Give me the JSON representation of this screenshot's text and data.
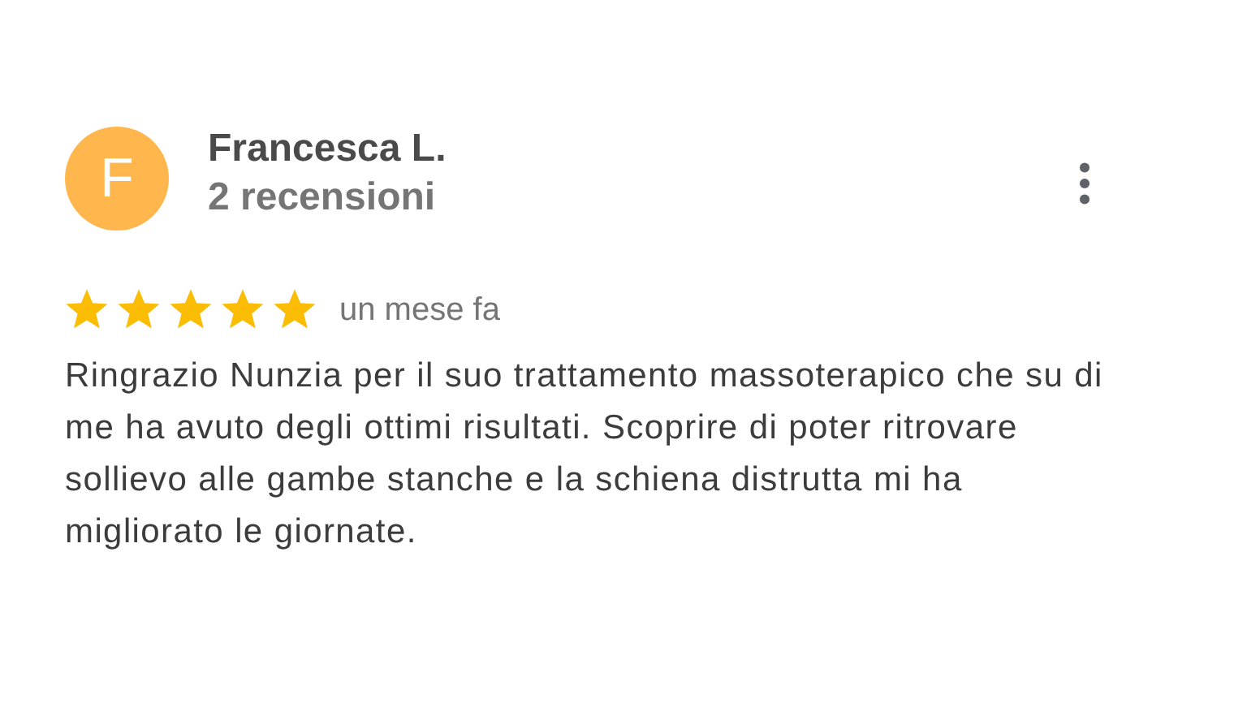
{
  "review": {
    "avatar": {
      "initial": "F",
      "color": "#ffb74d"
    },
    "author": "Francesca L.",
    "review_count": "2 recensioni",
    "stars": 5,
    "time": "un mese fa",
    "text": "Ringrazio Nunzia per il suo trattamento massoterapico che su di me ha avuto degli ottimi risultati. Scoprire di poter ritrovare sollievo alle gambe stanche e la schiena distrutta mi ha migliorato le giornate."
  }
}
